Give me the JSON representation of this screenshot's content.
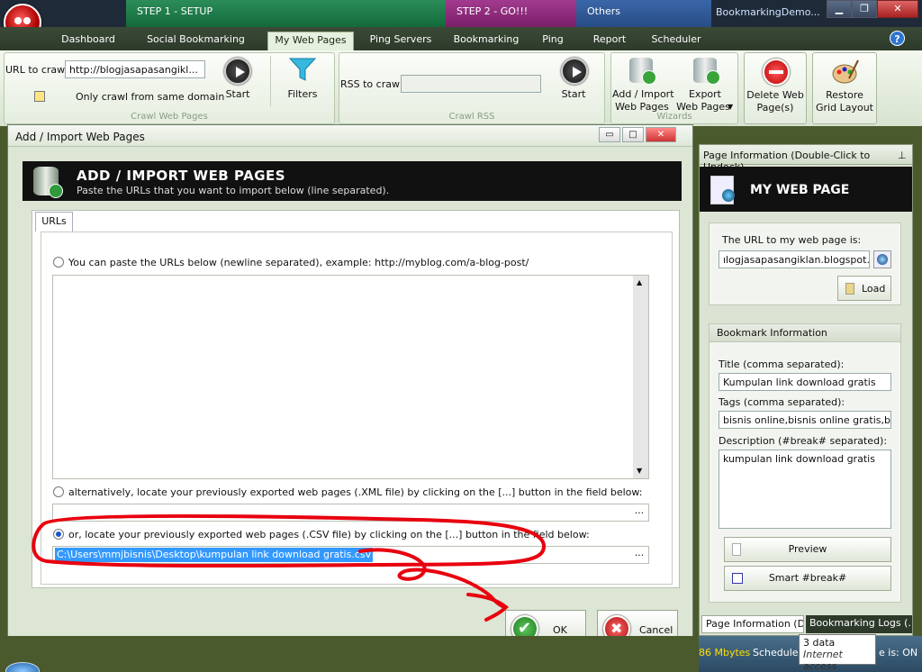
{
  "window": {
    "title": "BookmarkingDemo...",
    "steps": [
      "STEP 1 - SETUP",
      "STEP 2 - GO!!!",
      "Others"
    ],
    "controls": {
      "minimize": "▁",
      "maximize": "❐",
      "close": "✕"
    }
  },
  "tabs": [
    "Dashboard",
    "Social Bookmarking Sites",
    "My Web Pages",
    "Ping Servers",
    "Bookmarking",
    "Ping",
    "Report",
    "Scheduler"
  ],
  "help": "?",
  "ribbon": {
    "crawl": {
      "url_label": "URL to crawl:",
      "url_value": "http://blogjasapasangikl...",
      "only_same_domain": "Only crawl from same domain",
      "start": "Start",
      "filters": "Filters",
      "group_label": "Crawl Web Pages"
    },
    "rss": {
      "label": "RSS to crawl:",
      "value": "",
      "start": "Start",
      "group_label": "Crawl RSS"
    },
    "wizards": {
      "add_import": [
        "Add / Import",
        "Web Pages"
      ],
      "export": [
        "Export",
        "Web Pages"
      ],
      "group_label": "Wizards"
    },
    "delete": [
      "Delete Web",
      "Page(s)"
    ],
    "restore": [
      "Restore",
      "Grid Layout"
    ]
  },
  "dialog": {
    "title": "Add / Import Web Pages",
    "controls": {
      "minimize": "▭",
      "maximize": "□",
      "close": "✕"
    },
    "header_title": "ADD / IMPORT WEB PAGES",
    "header_sub": "Paste the URLs that you want to import below (line separated).",
    "tab": "URLs",
    "opt_paste": "You can paste the URLs below (newline separated), example: http://myblog.com/a-blog-post/",
    "opt_xml": "alternatively, locate your previously exported web pages (.XML file) by clicking on the [...] button in the field below:",
    "opt_csv": "or, locate your previously exported web pages (.CSV file) by clicking on the [...] button in the field below:",
    "xml_value": "",
    "csv_value": "C:\\Users\\mmjbisnis\\Desktop\\kumpulan link download gratis.csv",
    "browse": "...",
    "ok": "OK",
    "cancel": "Cancel"
  },
  "panel": {
    "title": "Page Information (Double-Click to Undock)",
    "pin": "⊥",
    "header": "MY WEB PAGE",
    "url_label": "The URL to my web page is:",
    "url_value": "ılogjasapasangiklan.blogspot.com",
    "load": "Load",
    "bookmark_section": "Bookmark Information",
    "title_label": "Title (comma separated):",
    "title_value": "Kumpulan link download gratis",
    "tags_label": "Tags (comma separated):",
    "tags_value": "bisnis online,bisnis online gratis,bisnis o",
    "desc_label": "Description (#break# separated):",
    "desc_value": "kumpulan link download gratis",
    "preview": "Preview",
    "smart_break": "Smart #break#",
    "bottom_tabs": [
      "Page Information (D...",
      "Bookmarking Logs (..."
    ]
  },
  "status": {
    "memory": "86 Mbytes",
    "scheduler": "Scheduler",
    "tooltip_line1": "3 data",
    "tooltip_line2": "Internet access",
    "online": "e is:  ON"
  },
  "colors": {
    "annotation": "#e8000e",
    "selection": "#3399ff"
  }
}
